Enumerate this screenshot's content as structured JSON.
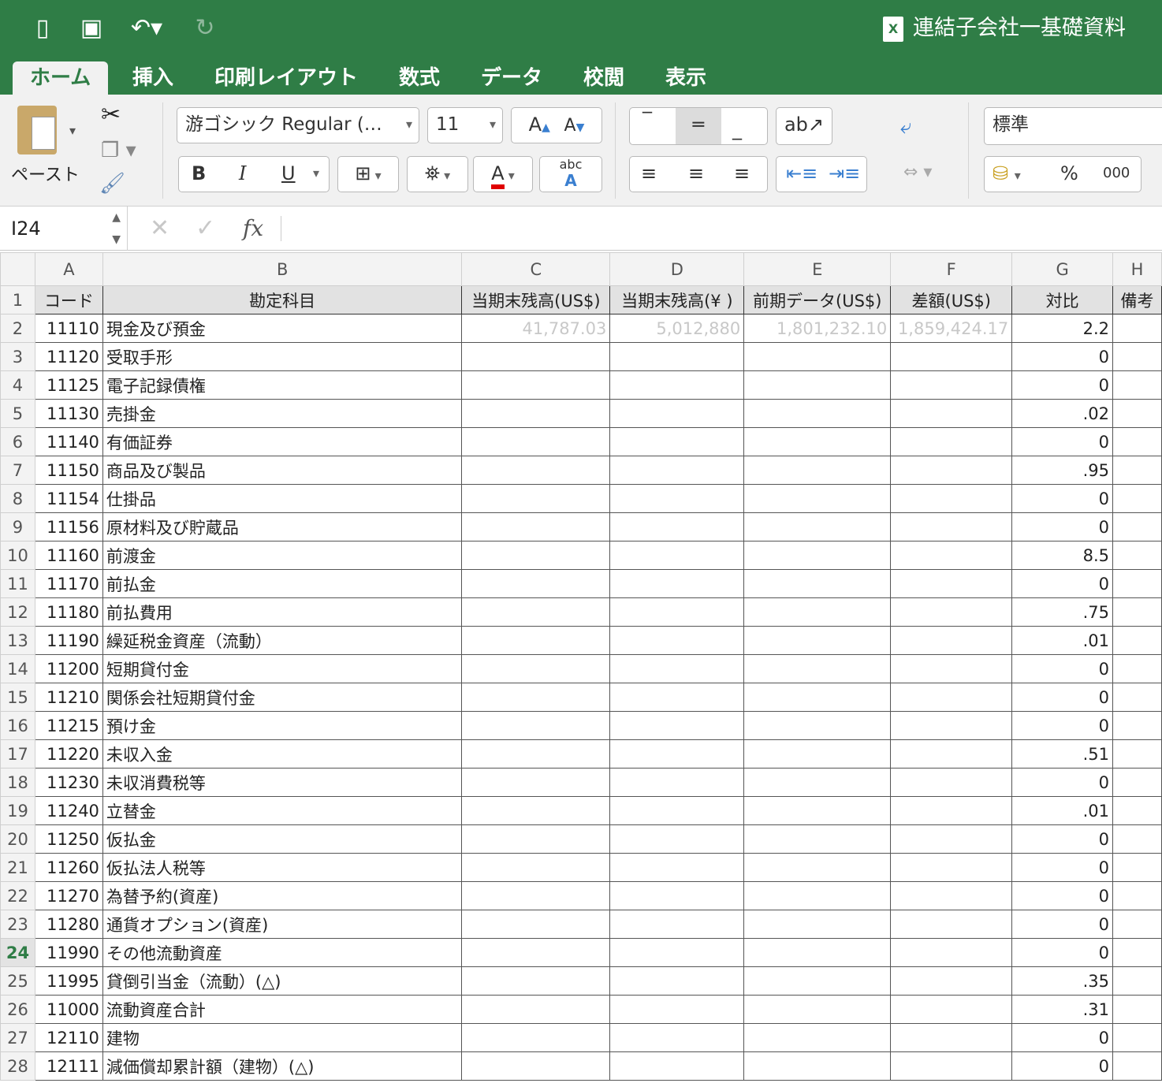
{
  "document_title": "連結子会社一基礎資料",
  "ribbon_tabs": [
    "ホーム",
    "挿入",
    "印刷レイアウト",
    "数式",
    "データ",
    "校閲",
    "表示"
  ],
  "ribbon": {
    "paste_label": "ペースト",
    "font_name": "游ゴシック Regular (…",
    "font_size": "11",
    "number_format": "標準",
    "bold": "B",
    "italic": "I",
    "underline": "U",
    "percent": "%",
    "thousands": "000"
  },
  "formula_bar": {
    "name_box": "I24",
    "fx": "fx",
    "value": ""
  },
  "selected_row": 24,
  "columns": [
    "A",
    "B",
    "C",
    "D",
    "E",
    "F",
    "G",
    "H"
  ],
  "headers": [
    "コード",
    "勘定科目",
    "当期末残高(US$)",
    "当期末残高(¥ )",
    "前期データ(US$)",
    "差額(US$)",
    "対比",
    "備考"
  ],
  "partial_values_row2": [
    "41,787.03",
    "5,012,880",
    "1,801,232.10",
    "1,859,424.17"
  ],
  "rows": [
    {
      "n": 2,
      "code": "11110",
      "name": "現金及び預金",
      "ratio": "2.2"
    },
    {
      "n": 3,
      "code": "11120",
      "name": "受取手形",
      "ratio": "0"
    },
    {
      "n": 4,
      "code": "11125",
      "name": "電子記録債権",
      "ratio": "0"
    },
    {
      "n": 5,
      "code": "11130",
      "name": "売掛金",
      "ratio": ".02"
    },
    {
      "n": 6,
      "code": "11140",
      "name": "有価証券",
      "ratio": "0"
    },
    {
      "n": 7,
      "code": "11150",
      "name": "商品及び製品",
      "ratio": ".95"
    },
    {
      "n": 8,
      "code": "11154",
      "name": "仕掛品",
      "ratio": "0"
    },
    {
      "n": 9,
      "code": "11156",
      "name": "原材料及び貯蔵品",
      "ratio": "0"
    },
    {
      "n": 10,
      "code": "11160",
      "name": "前渡金",
      "ratio": "8.5"
    },
    {
      "n": 11,
      "code": "11170",
      "name": "前払金",
      "ratio": "0"
    },
    {
      "n": 12,
      "code": "11180",
      "name": "前払費用",
      "ratio": ".75"
    },
    {
      "n": 13,
      "code": "11190",
      "name": "繰延税金資産（流動）",
      "ratio": ".01"
    },
    {
      "n": 14,
      "code": "11200",
      "name": "短期貸付金",
      "ratio": "0"
    },
    {
      "n": 15,
      "code": "11210",
      "name": "関係会社短期貸付金",
      "ratio": "0"
    },
    {
      "n": 16,
      "code": "11215",
      "name": "預け金",
      "ratio": "0"
    },
    {
      "n": 17,
      "code": "11220",
      "name": "未収入金",
      "ratio": ".51"
    },
    {
      "n": 18,
      "code": "11230",
      "name": "未収消費税等",
      "ratio": "0"
    },
    {
      "n": 19,
      "code": "11240",
      "name": "立替金",
      "ratio": ".01"
    },
    {
      "n": 20,
      "code": "11250",
      "name": "仮払金",
      "ratio": "0"
    },
    {
      "n": 21,
      "code": "11260",
      "name": "仮払法人税等",
      "ratio": "0"
    },
    {
      "n": 22,
      "code": "11270",
      "name": "為替予約(資産)",
      "ratio": "0"
    },
    {
      "n": 23,
      "code": "11280",
      "name": "通貨オプション(資産)",
      "ratio": "0"
    },
    {
      "n": 24,
      "code": "11990",
      "name": "その他流動資産",
      "ratio": "0"
    },
    {
      "n": 25,
      "code": "11995",
      "name": "貸倒引当金（流動）(△)",
      "ratio": ".35"
    },
    {
      "n": 26,
      "code": "11000",
      "name": "流動資産合計",
      "ratio": ".31"
    },
    {
      "n": 27,
      "code": "12110",
      "name": "建物",
      "ratio": "0"
    },
    {
      "n": 28,
      "code": "12111",
      "name": "減価償却累計額（建物）(△)",
      "ratio": "0"
    }
  ]
}
